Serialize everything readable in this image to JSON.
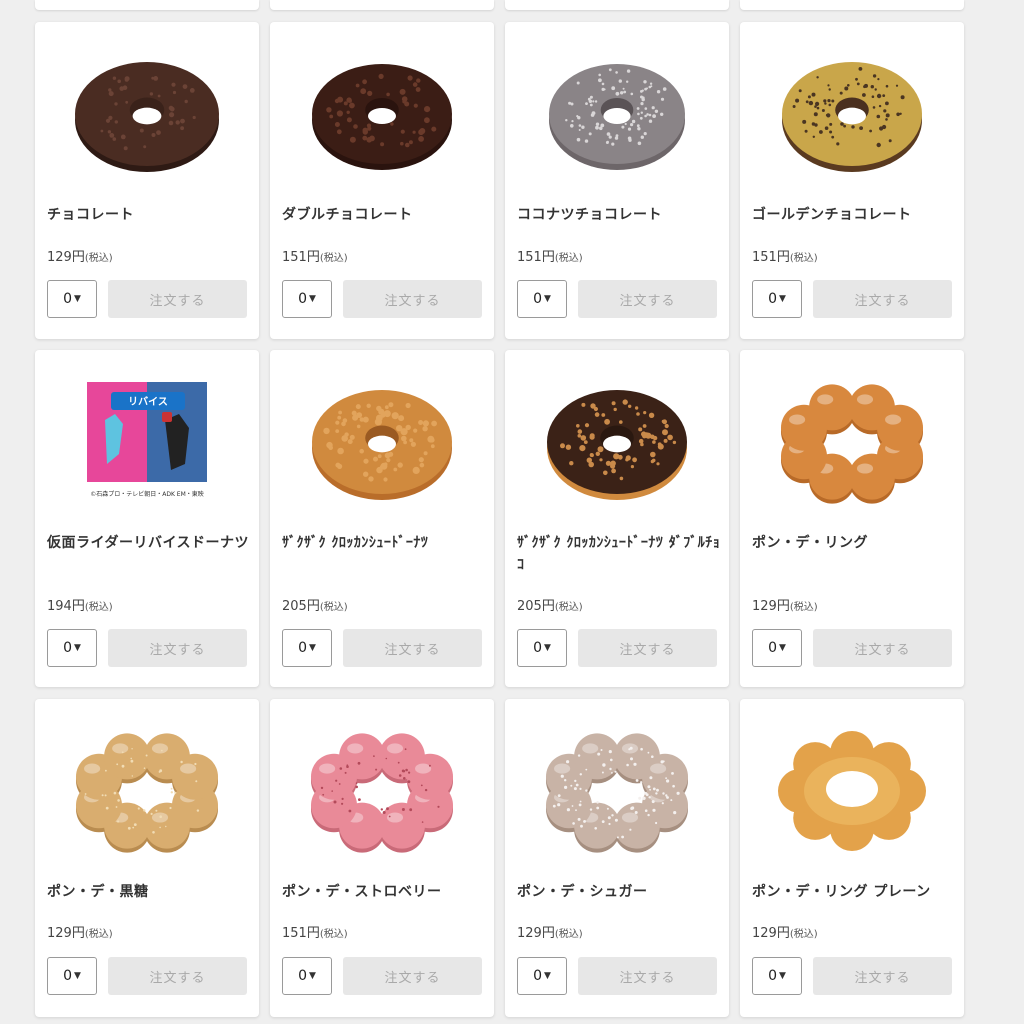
{
  "products": [
    {
      "name": "チョコレート",
      "price": "129円",
      "tax": "(税込)",
      "qty": "0",
      "order_label": "注文する",
      "image": "chocolate-donut"
    },
    {
      "name": "ダブルチョコレート",
      "price": "151円",
      "tax": "(税込)",
      "qty": "0",
      "order_label": "注文する",
      "image": "double-chocolate-donut"
    },
    {
      "name": "ココナツチョコレート",
      "price": "151円",
      "tax": "(税込)",
      "qty": "0",
      "order_label": "注文する",
      "image": "coconut-chocolate-donut"
    },
    {
      "name": "ゴールデンチョコレート",
      "price": "151円",
      "tax": "(税込)",
      "qty": "0",
      "order_label": "注文する",
      "image": "golden-chocolate-donut"
    },
    {
      "name": "仮面ライダーリバイスドーナツ",
      "price": "194円",
      "tax": "(税込)",
      "qty": "0",
      "order_label": "注文する",
      "image": "kamen-rider-revice-box",
      "box_caption": "リバイス",
      "box_copyright": "©石森プロ・テレビ朝日・ADK EM・東映"
    },
    {
      "name": "ｻﾞｸｻﾞｸ ｸﾛｯｶﾝｼｭｰﾄﾞｰﾅﾂ",
      "price": "205円",
      "tax": "(税込)",
      "qty": "0",
      "order_label": "注文する",
      "image": "crunchy-croquant-donut"
    },
    {
      "name": "ｻﾞｸｻﾞｸ ｸﾛｯｶﾝｼｭｰﾄﾞｰﾅﾂ ﾀﾞﾌﾞﾙﾁｮｺ",
      "price": "205円",
      "tax": "(税込)",
      "qty": "0",
      "order_label": "注文する",
      "image": "crunchy-croquant-double-choco-donut"
    },
    {
      "name": "ポン・デ・リング",
      "price": "129円",
      "tax": "(税込)",
      "qty": "0",
      "order_label": "注文する",
      "image": "pon-de-ring"
    },
    {
      "name": "ポン・デ・黒糖",
      "price": "129円",
      "tax": "(税込)",
      "qty": "0",
      "order_label": "注文する",
      "image": "pon-de-kokuto"
    },
    {
      "name": "ポン・デ・ストロベリー",
      "price": "151円",
      "tax": "(税込)",
      "qty": "0",
      "order_label": "注文する",
      "image": "pon-de-strawberry"
    },
    {
      "name": "ポン・デ・シュガー",
      "price": "129円",
      "tax": "(税込)",
      "qty": "0",
      "order_label": "注文する",
      "image": "pon-de-sugar"
    },
    {
      "name": "ポン・デ・リング プレーン",
      "price": "129円",
      "tax": "(税込)",
      "qty": "0",
      "order_label": "注文する",
      "image": "pon-de-ring-plain"
    }
  ]
}
